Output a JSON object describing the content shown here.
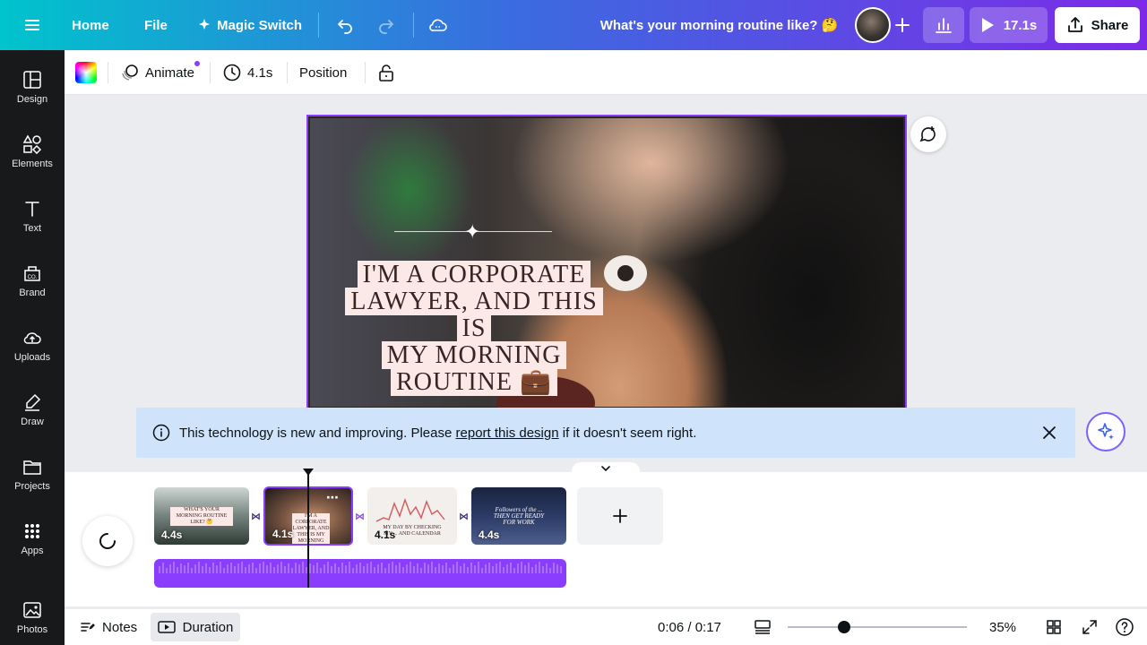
{
  "topbar": {
    "home": "Home",
    "file": "File",
    "magic_switch": "Magic Switch",
    "doc_title": "What's your morning routine like? 🤔",
    "play_duration": "17.1s",
    "share": "Share"
  },
  "rail": {
    "items": [
      {
        "label": "Design",
        "icon": "design-icon"
      },
      {
        "label": "Elements",
        "icon": "elements-icon"
      },
      {
        "label": "Text",
        "icon": "text-icon"
      },
      {
        "label": "Brand",
        "icon": "brand-icon"
      },
      {
        "label": "Uploads",
        "icon": "uploads-icon"
      },
      {
        "label": "Draw",
        "icon": "draw-icon"
      },
      {
        "label": "Projects",
        "icon": "projects-icon"
      },
      {
        "label": "Apps",
        "icon": "apps-icon"
      },
      {
        "label": "Photos",
        "icon": "photos-icon"
      }
    ]
  },
  "toolbar": {
    "animate": "Animate",
    "duration": "4.1s",
    "position": "Position"
  },
  "canvas": {
    "caption_lines": [
      "I'M A CORPORATE",
      "LAWYER, AND THIS IS",
      "MY MORNING",
      "ROUTINE 💼"
    ]
  },
  "notice": {
    "text_before": "This technology is new and improving. Please",
    "link": "report this design",
    "text_after": "if it doesn't seem right."
  },
  "timeline": {
    "clips": [
      {
        "duration": "4.4s",
        "mini_text": "WHAT'S YOUR MORNING ROUTINE LIKE? 🤔"
      },
      {
        "duration": "4.1s",
        "mini_text": "I'M A CORPORATE LAWYER, AND THIS IS MY MORNING ROUTINE"
      },
      {
        "duration": "4.1s",
        "mini_text": "MY DAY BY CHECKING MY ... AND CALENDAR"
      },
      {
        "duration": "4.4s",
        "mini_text": "Followers of the ... THEN GET READY FOR WORK"
      }
    ]
  },
  "bottombar": {
    "notes": "Notes",
    "duration": "Duration",
    "time": "0:06 / 0:17",
    "zoom": "35%"
  },
  "colors": {
    "accent": "#8b3dff",
    "notice_bg": "#cfe3fb",
    "rail_bg": "#18191b"
  }
}
